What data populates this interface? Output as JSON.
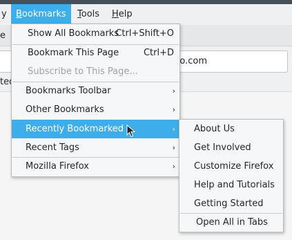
{
  "menubar": {
    "items": [
      {
        "label": "y"
      },
      {
        "label": "Bookmarks",
        "accel": "B",
        "rest": "ookmarks"
      },
      {
        "label": "Tools",
        "accel": "T",
        "rest": "ools"
      },
      {
        "label": "Help",
        "accel": "H",
        "rest": "elp"
      }
    ]
  },
  "tab_partial": "e",
  "url_partial": "go.com",
  "bmbar_partial": "ted",
  "bookmarks_menu": {
    "items": [
      {
        "label": "Show All Bookmarks",
        "shortcut": "Ctrl+Shift+O"
      },
      {
        "label": "Bookmark This Page",
        "shortcut": "Ctrl+D"
      },
      {
        "label": "Subscribe to This Page..."
      },
      {
        "label": "Bookmarks Toolbar"
      },
      {
        "label": "Other Bookmarks"
      },
      {
        "label": "Recently Bookmarked"
      },
      {
        "label": "Recent Tags"
      },
      {
        "label": "Mozilla Firefox"
      }
    ]
  },
  "recent_menu": {
    "items": [
      {
        "label": "About Us"
      },
      {
        "label": "Get Involved"
      },
      {
        "label": "Customize Firefox"
      },
      {
        "label": "Help and Tutorials"
      },
      {
        "label": "Getting Started"
      },
      {
        "label": "Open All in Tabs"
      }
    ]
  },
  "icons": {
    "submenu_arrow": "›"
  },
  "colors": {
    "highlight": "#3daee9",
    "menu_bg": "#f6f7f8",
    "disabled": "#a0a3a6"
  }
}
